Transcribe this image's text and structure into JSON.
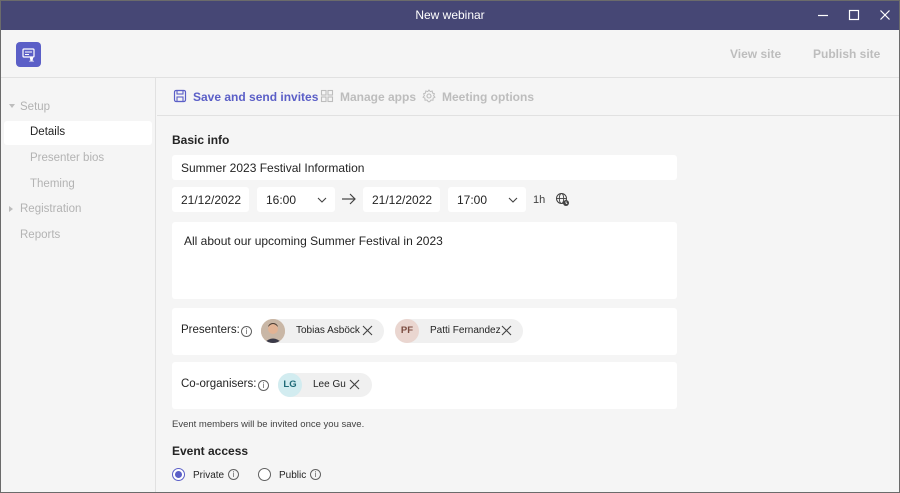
{
  "window": {
    "title": "New webinar"
  },
  "header": {
    "view_site": "View site",
    "publish_site": "Publish site"
  },
  "sidebar": {
    "items": [
      {
        "label": "Setup",
        "state": "expanded"
      },
      {
        "label": "Details",
        "state": "selected"
      },
      {
        "label": "Presenter bios"
      },
      {
        "label": "Theming"
      },
      {
        "label": "Registration",
        "state": "collapsed"
      },
      {
        "label": "Reports"
      }
    ]
  },
  "toolbar": {
    "save_label": "Save and send invites",
    "apps_label": "Manage apps",
    "options_label": "Meeting options"
  },
  "basic_info": {
    "heading": "Basic info",
    "title": "Summer 2023 Festival Information",
    "start_date": "21/12/2022",
    "start_time": "16:00",
    "end_date": "21/12/2022",
    "end_time": "17:00",
    "duration": "1h",
    "description": "All about our upcoming Summer Festival in 2023"
  },
  "presenters": {
    "label": "Presenters:",
    "people": [
      {
        "name": "Tobias Asböck",
        "initials": ""
      },
      {
        "name": "Patti Fernandez",
        "initials": "PF"
      }
    ]
  },
  "coorganisers": {
    "label": "Co-organisers:",
    "people": [
      {
        "name": "Lee Gu",
        "initials": "LG"
      }
    ]
  },
  "note": "Event members will be invited once you save.",
  "event_access": {
    "heading": "Event access",
    "options": [
      {
        "label": "Private",
        "selected": true
      },
      {
        "label": "Public",
        "selected": false
      }
    ]
  },
  "colors": {
    "accent": "#5b5fc7",
    "titlebar": "#464775"
  }
}
